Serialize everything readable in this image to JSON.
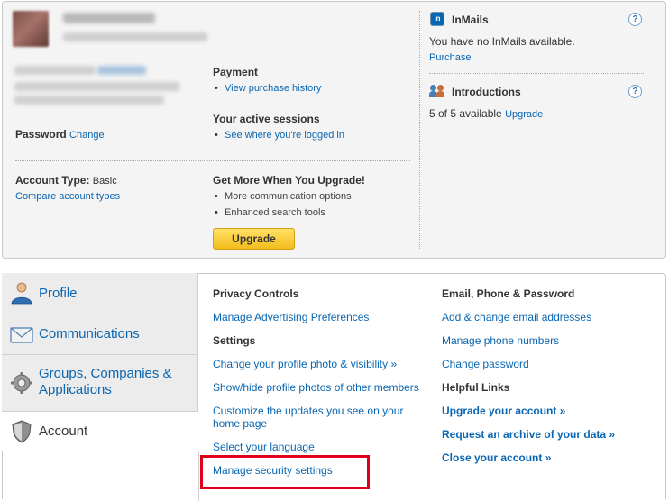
{
  "account": {
    "password_label": "Password",
    "password_change": "Change",
    "account_type_label": "Account Type:",
    "account_type_value": "Basic",
    "compare_link": "Compare account types"
  },
  "payment": {
    "title": "Payment",
    "items": [
      "View purchase history"
    ]
  },
  "sessions": {
    "title": "Your active sessions",
    "items": [
      "See where you're logged in"
    ]
  },
  "upgrade_promo": {
    "title": "Get More When You Upgrade!",
    "items": [
      "More communication options",
      "Enhanced search tools"
    ],
    "button": "Upgrade"
  },
  "inmails": {
    "title": "InMails",
    "message": "You have no InMails available.",
    "link": "Purchase",
    "help": "?"
  },
  "introductions": {
    "title": "Introductions",
    "message": "5 of 5 available",
    "link": "Upgrade",
    "help": "?"
  },
  "tabs": [
    {
      "label": "Profile",
      "icon": "profile-icon"
    },
    {
      "label": "Communications",
      "icon": "envelope-icon"
    },
    {
      "label": "Groups, Companies &",
      "label2": "Applications",
      "icon": "gear-icon"
    },
    {
      "label": "Account",
      "icon": "shield-icon",
      "active": true
    }
  ],
  "left_col": {
    "privacy_title": "Privacy Controls",
    "privacy_links": [
      "Manage Advertising Preferences"
    ],
    "settings_title": "Settings",
    "settings_links": [
      "Change your profile photo & visibility »",
      "Show/hide profile photos of other members",
      "Customize the updates you see on your",
      "home page",
      "Select your language",
      "Manage security settings"
    ]
  },
  "right_col": {
    "email_title": "Email, Phone & Password",
    "email_links": [
      "Add & change email addresses",
      "Manage phone numbers",
      "Change password"
    ],
    "helpful_title": "Helpful Links",
    "helpful_links": [
      "Upgrade your account »",
      "Request an archive of your data »",
      "Close your account »"
    ]
  },
  "colors": {
    "link": "#0a66b2",
    "highlight": "#e0001b",
    "button": "#f4bd1c"
  }
}
